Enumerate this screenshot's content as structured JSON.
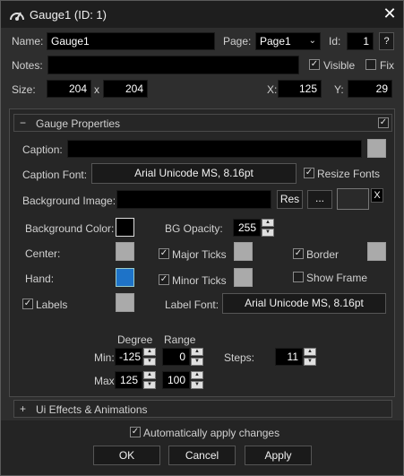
{
  "window": {
    "title": "Gauge1 (ID: 1)",
    "close": "✕"
  },
  "general": {
    "name_label": "Name:",
    "name_value": "Gauge1",
    "page_label": "Page:",
    "page_value": "Page1",
    "id_label": "Id:",
    "id_value": "1",
    "help": "?",
    "notes_label": "Notes:",
    "notes_value": "",
    "visible_label": "Visible",
    "visible_checked": true,
    "fix_label": "Fix",
    "fix_checked": false,
    "size_label": "Size:",
    "width": "204",
    "size_sep": "x",
    "height": "204",
    "x_label": "X:",
    "x_value": "125",
    "y_label": "Y:",
    "y_value": "29"
  },
  "gauge": {
    "header_sign": "−",
    "header": "Gauge Properties",
    "header_checked": true,
    "caption_label": "Caption:",
    "caption_value": "",
    "caption_font_label": "Caption Font:",
    "caption_font": "Arial Unicode MS, 8.16pt",
    "resize_fonts_label": "Resize Fonts",
    "resize_fonts_checked": true,
    "bg_image_label": "Background Image:",
    "bg_image_value": "",
    "res": "Res",
    "browse": "...",
    "clear": "X",
    "bg_color_label": "Background Color:",
    "bg_opacity_label": "BG Opacity:",
    "bg_opacity": "255",
    "center_label": "Center:",
    "major_ticks_label": "Major Ticks",
    "major_ticks_checked": true,
    "border_label": "Border",
    "border_checked": true,
    "hand_label": "Hand:",
    "minor_ticks_label": "Minor Ticks",
    "minor_ticks_checked": true,
    "show_frame_label": "Show Frame",
    "show_frame_checked": false,
    "labels_label": "Labels",
    "labels_checked": true,
    "label_font_label": "Label Font:",
    "label_font": "Arial Unicode MS, 8.16pt",
    "degree_header": "Degree",
    "range_header": "Range",
    "min_label": "Min:",
    "degree_min": "-125",
    "range_min": "0",
    "steps_label": "Steps:",
    "steps": "11",
    "max_label": "Max:",
    "degree_max": "125",
    "range_max": "100",
    "colors": {
      "bg": "#000000",
      "center": "#aaaaaa",
      "major_ticks": "#aaaaaa",
      "border": "#aaaaaa",
      "hand": "#1e73c8",
      "minor_ticks": "#aaaaaa",
      "labels": "#aaaaaa",
      "caption": "#aaaaaa"
    }
  },
  "effects": {
    "sign": "+",
    "header": "Ui Effects & Animations"
  },
  "footer": {
    "auto_apply_label": "Automatically apply changes",
    "auto_apply_checked": true,
    "ok": "OK",
    "cancel": "Cancel",
    "apply": "Apply"
  }
}
